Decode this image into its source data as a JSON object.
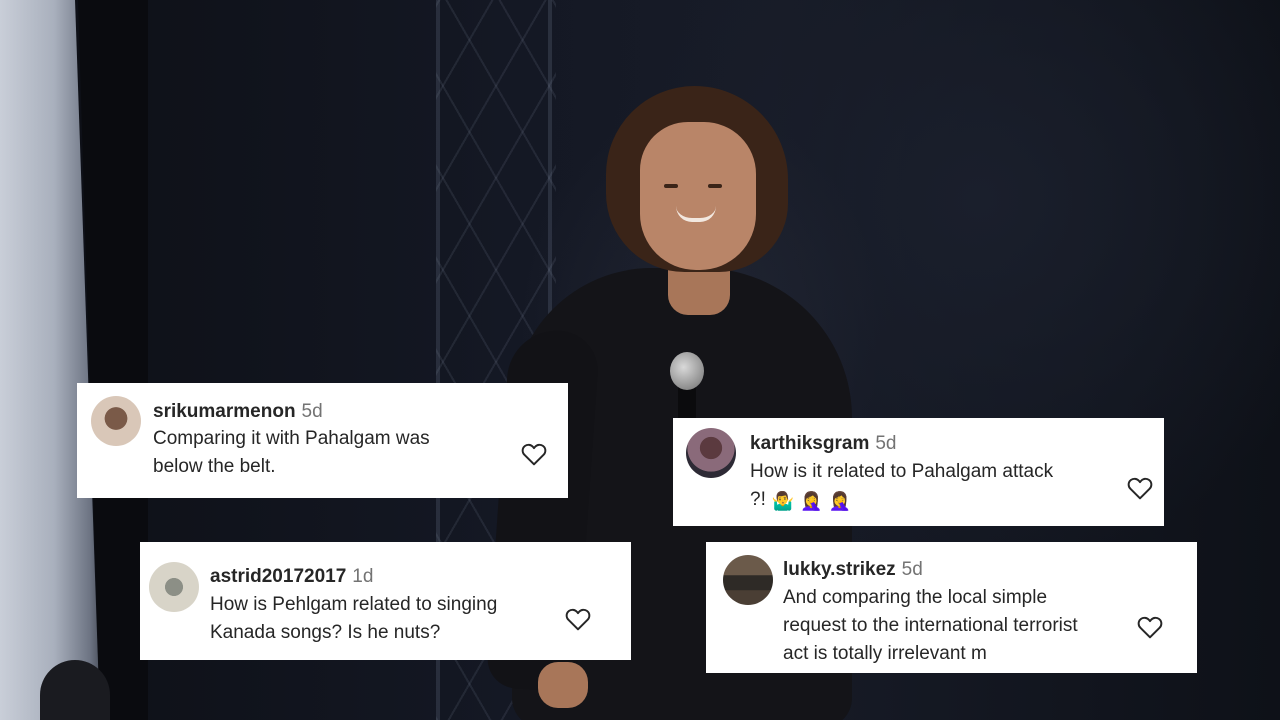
{
  "comments": [
    {
      "username": "srikumarmenon",
      "time": "5d",
      "lines": [
        "Comparing it with Pahalgam was",
        "below the belt."
      ],
      "avatar_icon": "user-avatar-icon"
    },
    {
      "username": "karthiksgram",
      "time": "5d",
      "lines": [
        "How is it related to Pahalgam attack",
        "?!"
      ],
      "emojis": [
        "🤷‍♂️",
        "🤦‍♀️",
        "🤦‍♀️"
      ],
      "avatar_icon": "user-avatar-icon"
    },
    {
      "username": "astrid20172017",
      "time": "1d",
      "lines": [
        "How is Pehlgam related to singing",
        "Kanada songs? Is he nuts?"
      ],
      "avatar_icon": "user-avatar-icon"
    },
    {
      "username": "lukky.strikez",
      "time": "5d",
      "lines": [
        "And comparing the local simple",
        "request to the international terrorist",
        "act is totally irrelevant m"
      ],
      "avatar_icon": "user-avatar-icon"
    }
  ],
  "like_icon": "heart-icon",
  "colors": {
    "card_bg": "#ffffff",
    "text": "#262626",
    "muted": "#737373"
  }
}
